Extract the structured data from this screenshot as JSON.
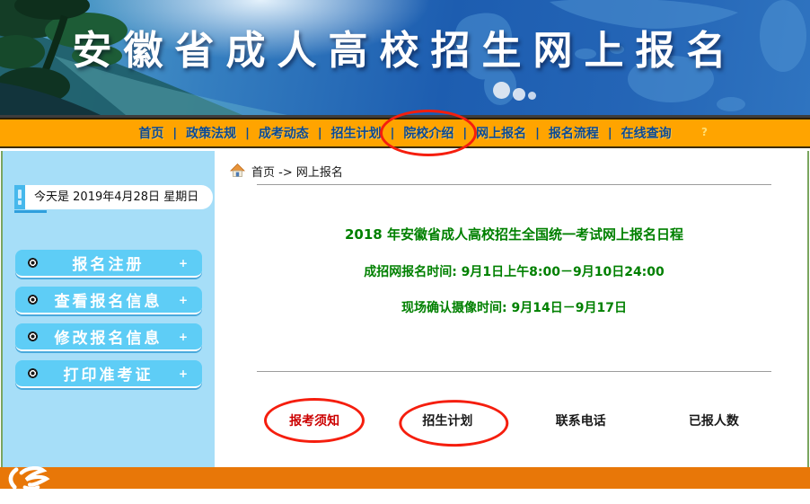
{
  "header": {
    "title": "安徽省成人高校招生网上报名"
  },
  "nav": {
    "separator": "|",
    "hint": "?",
    "items": [
      "首页",
      "政策法规",
      "成考动态",
      "招生计划",
      "院校介绍",
      "网上报名",
      "报名流程",
      "在线查询"
    ],
    "circled_item": "院校介绍"
  },
  "sidebar": {
    "today_prefix": "今天是",
    "date": "2019年4月28日",
    "weekday": "星期日",
    "menu": [
      "报名注册",
      "查看报名信息",
      "修改报名信息",
      "打印准考证"
    ],
    "plus": "+"
  },
  "breadcrumb": {
    "home": "首页",
    "arrow": "->",
    "current": "网上报名"
  },
  "main": {
    "schedule_title": "2018 年安徽省成人高校招生全国统一考试网上报名日程",
    "reg_time": "成招网报名时间: 9月1日上午8:00－9月10日24:00",
    "confirm_time": "现场确认摄像时间: 9月14日－9月17日",
    "links": [
      "报考须知",
      "招生计划",
      "联系电话",
      "已报人数"
    ],
    "circled_links": [
      "报考须知",
      "招生计划"
    ]
  },
  "icons": {
    "breadcrumb_home": "home-icon",
    "date_tab": "date-tab-icon",
    "menu_bullet": "bullet-icon",
    "menu_expand": "plus-icon",
    "footer_logo": "swirl-logo-icon",
    "header_dots": "dots-decoration"
  },
  "colors": {
    "nav_bar": "#FFA400",
    "footer_bar": "#E87708",
    "sidebar_bg": "#A6DEF8",
    "button_blue": "#5ECDF6",
    "green_text": "#008000",
    "annotation_red": "#F51E0E",
    "link_red": "#CC0000",
    "nav_text": "#0A4A96"
  }
}
